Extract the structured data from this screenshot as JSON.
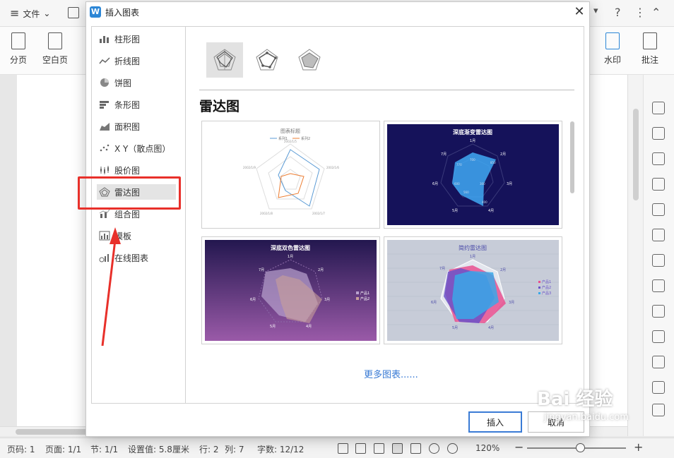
{
  "app": {
    "menu_label": "文件"
  },
  "ribbon": {
    "fenye": "分页",
    "kongbaiye": "空白页",
    "shuiyin": "水印",
    "pizhu": "批注"
  },
  "dialog": {
    "title": "插入图表",
    "logo": "W",
    "categories": [
      {
        "label": "柱形图",
        "icon": "bar-chart-icon"
      },
      {
        "label": "折线图",
        "icon": "line-chart-icon"
      },
      {
        "label": "饼图",
        "icon": "pie-chart-icon"
      },
      {
        "label": "条形图",
        "icon": "horizontal-bar-icon"
      },
      {
        "label": "面积图",
        "icon": "area-chart-icon"
      },
      {
        "label": "X Y（散点图）",
        "icon": "scatter-icon"
      },
      {
        "label": "股价图",
        "icon": "stock-chart-icon"
      },
      {
        "label": "雷达图",
        "icon": "radar-chart-icon",
        "selected": true
      },
      {
        "label": "组合图",
        "icon": "combo-chart-icon"
      },
      {
        "label": "模板",
        "icon": "template-icon"
      },
      {
        "label": "在线图表",
        "icon": "online-chart-icon"
      }
    ],
    "section_title": "雷达图",
    "cards": [
      {
        "title": "图表标题",
        "legend": [
          "系列1",
          "系列2"
        ],
        "labels": [
          "2002/1/5",
          "2002/1/6",
          "2002/1/7",
          "2002/1/8",
          "2002/1/9"
        ],
        "bg": "#ffffff",
        "fg": "#666666"
      },
      {
        "title": "深底渐变雷达图",
        "labels": [
          "1月",
          "2月",
          "3月",
          "4月",
          "5月",
          "6月",
          "7月"
        ],
        "values_text": [
          "700",
          "850",
          "300",
          "400",
          "560",
          "600",
          "770"
        ],
        "bg": "#15125a",
        "fg": "#ffffff"
      },
      {
        "title": "深底双色雷达图",
        "labels": [
          "1月",
          "2月",
          "3月",
          "4月",
          "5月",
          "6月",
          "7月"
        ],
        "legend": [
          "产品1",
          "产品2"
        ],
        "bg": "#4a2a6e",
        "fg": "#ffffff"
      },
      {
        "title": "简约雷达图",
        "labels": [
          "1月",
          "2月",
          "3月",
          "4月",
          "5月",
          "6月",
          "7月"
        ],
        "legend": [
          "产品1",
          "产品2",
          "产品3"
        ],
        "bg": "#c7ccd8",
        "fg": "#4a4aa8"
      }
    ],
    "more_link": "更多图表......",
    "insert_button": "插入",
    "cancel_button": "取消"
  },
  "status": {
    "page": "页码: 1",
    "pages": "页面: 1/1",
    "section": "节: 1/1",
    "setting": "设置值: 5.8厘米",
    "row": "行: 2",
    "col": "列: 7",
    "chars": "字数: 12/12",
    "zoom": "120%"
  },
  "watermark": {
    "brand": "Bai 经验",
    "url": "jingyan.baidu.com"
  }
}
